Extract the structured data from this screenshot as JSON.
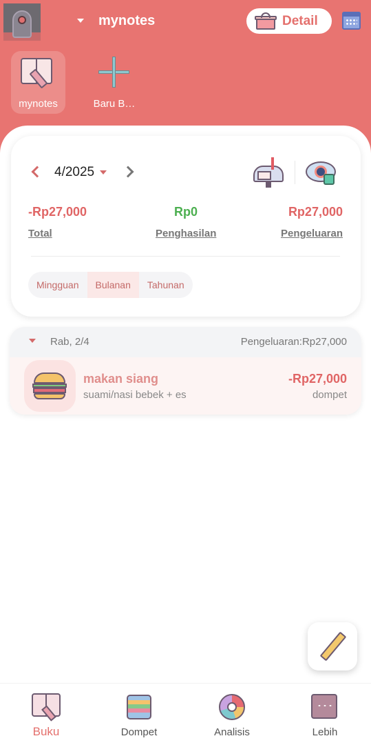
{
  "header": {
    "book_name": "mynotes",
    "detail_label": "Detail",
    "books": [
      {
        "label": "mynotes",
        "icon": "book-icon"
      },
      {
        "label": "Baru B…",
        "icon": "plus-icon"
      }
    ],
    "accent_color": "#e87471"
  },
  "summary": {
    "period": "4/2025",
    "total_value": "-Rp27,000",
    "total_label": "Total",
    "income_value": "Rp0",
    "income_label": "Penghasilan",
    "expense_value": "Rp27,000",
    "expense_label": "Pengeluaran",
    "tabs": [
      "Mingguan",
      "Bulanan",
      "Tahunan"
    ],
    "active_tab": "Bulanan",
    "colors": {
      "expense": "#e06565",
      "income": "#4caf50"
    }
  },
  "day_groups": [
    {
      "date": "Rab, 2/4",
      "total": "Pengeluaran:Rp27,000",
      "transactions": [
        {
          "title": "makan siang",
          "note": "suami/nasi bebek + es",
          "amount": "-Rp27,000",
          "wallet": "dompet",
          "icon": "burger-icon"
        }
      ]
    }
  ],
  "nav": {
    "items": [
      {
        "label": "Buku",
        "icon": "book-icon",
        "active": true
      },
      {
        "label": "Dompet",
        "icon": "wallet-icon",
        "active": false
      },
      {
        "label": "Analisis",
        "icon": "pie-chart-icon",
        "active": false
      },
      {
        "label": "Lebih",
        "icon": "more-icon",
        "active": false
      }
    ],
    "active_color": "#e4706d"
  }
}
